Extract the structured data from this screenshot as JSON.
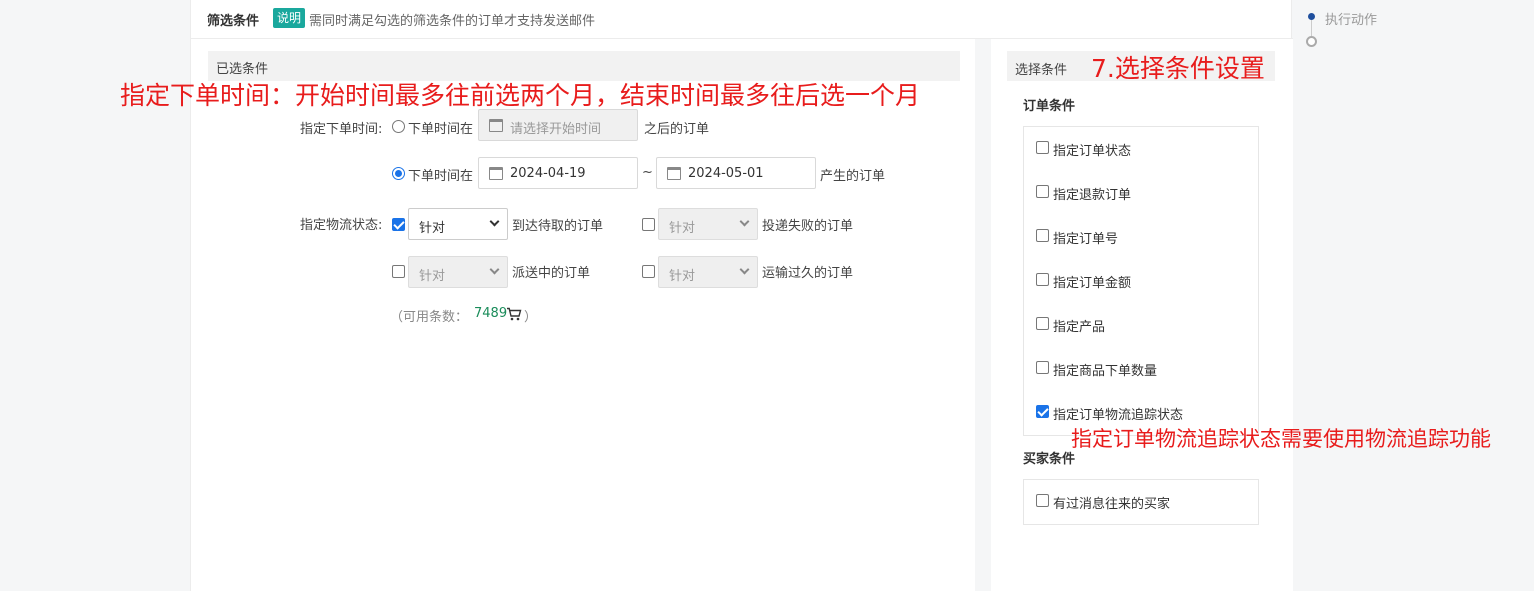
{
  "header": {
    "title": "筛选条件",
    "badge": "说明",
    "description": "需同时满足勾选的筛选条件的订单才支持发送邮件"
  },
  "left": {
    "selected_label": "已选条件",
    "annotation": "指定下单时间：开始时间最多往前选两个月，结束时间最多往后选一个月",
    "order_time": {
      "label": "指定下单时间:",
      "option1_label": "下单时间在",
      "option1_placeholder": "请选择开始时间",
      "option1_suffix": "之后的订单",
      "option2_label": "下单时间在",
      "start_date": "2024-04-19",
      "separator": "~",
      "end_date": "2024-05-01",
      "option2_suffix": "产生的订单"
    },
    "logistics": {
      "label": "指定物流状态:",
      "items": [
        {
          "select": "针对",
          "text": "到达待取的订单",
          "checked": true
        },
        {
          "select": "针对",
          "text": "投递失败的订单",
          "checked": false
        },
        {
          "select": "针对",
          "text": "派送中的订单",
          "checked": false
        },
        {
          "select": "针对",
          "text": "运输过久的订单",
          "checked": false
        }
      ]
    },
    "available": {
      "prefix": "（可用条数：",
      "count": "7489",
      "suffix": "）"
    }
  },
  "right": {
    "header_label": "选择条件",
    "annotation_step": "7.选择条件设置",
    "order_group_title": "订单条件",
    "order_items": [
      {
        "label": "指定订单状态",
        "checked": false
      },
      {
        "label": "指定退款订单",
        "checked": false
      },
      {
        "label": "指定订单号",
        "checked": false
      },
      {
        "label": "指定订单金额",
        "checked": false
      },
      {
        "label": "指定产品",
        "checked": false
      },
      {
        "label": "指定商品下单数量",
        "checked": false
      },
      {
        "label": "指定订单物流追踪状态",
        "checked": true
      }
    ],
    "annotation_tracking": "指定订单物流追踪状态需要使用物流追踪功能",
    "buyer_group_title": "买家条件",
    "buyer_items": [
      {
        "label": "有过消息往来的买家",
        "checked": false
      }
    ]
  },
  "timeline": {
    "label": "执行动作"
  }
}
